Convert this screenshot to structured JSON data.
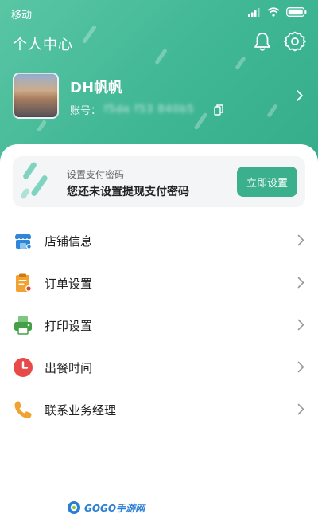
{
  "status_bar": {
    "carrier": "移动"
  },
  "header": {
    "title": "个人中心",
    "user_name": "DH帆帆",
    "account_label": "账号：",
    "account_value": "f5de f53 840b5"
  },
  "pay_card": {
    "subtitle": "设置支付密码",
    "title": "您还未设置提现支付密码",
    "button_label": "立即设置"
  },
  "menu": [
    {
      "label": "店铺信息",
      "icon": "store-icon",
      "color": "#2f86d6"
    },
    {
      "label": "订单设置",
      "icon": "order-clipboard-icon",
      "color": "#f0a233"
    },
    {
      "label": "打印设置",
      "icon": "printer-icon",
      "color": "#43a047"
    },
    {
      "label": "出餐时间",
      "icon": "clock-icon",
      "color": "#e84a4a"
    },
    {
      "label": "联系业务经理",
      "icon": "phone-icon",
      "color": "#f0a233"
    }
  ],
  "watermark": {
    "text": "GOGO手游网"
  },
  "colors": {
    "brand_green": "#3fb694",
    "button_green": "#3bb08d"
  }
}
